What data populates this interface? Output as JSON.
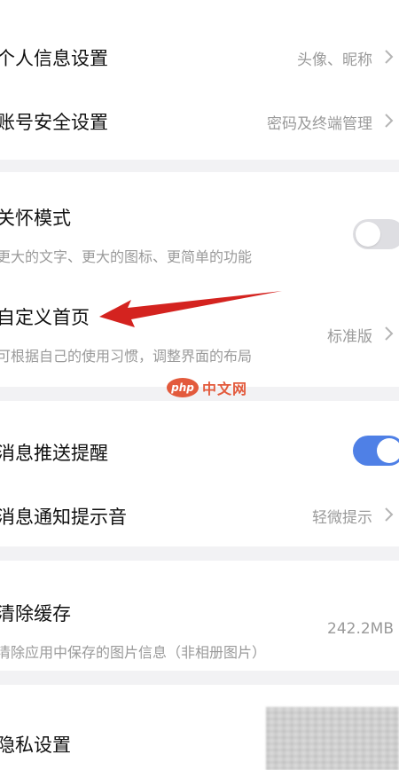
{
  "colors": {
    "accent": "#4f80e6",
    "arrow": "#d4231f",
    "watermark": "#e35a3c"
  },
  "account": {
    "personal_info": {
      "title": "个人信息设置",
      "value": "头像、昵称"
    },
    "account_security": {
      "title": "账号安全设置",
      "value": "密码及终端管理"
    }
  },
  "display": {
    "care_mode": {
      "title": "关怀模式",
      "subtitle": "更大的文字、更大的图标、更简单的功能",
      "enabled": false
    },
    "custom_home": {
      "title": "自定义首页",
      "subtitle": "可根据自己的使用习惯，调整界面的布局",
      "value": "标准版"
    }
  },
  "notifications": {
    "push_reminder": {
      "title": "消息推送提醒",
      "enabled": true
    },
    "notify_sound": {
      "title": "消息通知提示音",
      "value": "轻微提示"
    }
  },
  "storage": {
    "clear_cache": {
      "title": "清除缓存",
      "subtitle": "清除应用中保存的图片信息（非相册图片）",
      "value": "242.2MB"
    }
  },
  "privacy": {
    "title": "隐私设置"
  },
  "watermark": {
    "logo": "php",
    "text": "中文网"
  },
  "icons": {
    "chevron": "chevron-right-icon",
    "annotation": "red-arrow-annotation"
  }
}
